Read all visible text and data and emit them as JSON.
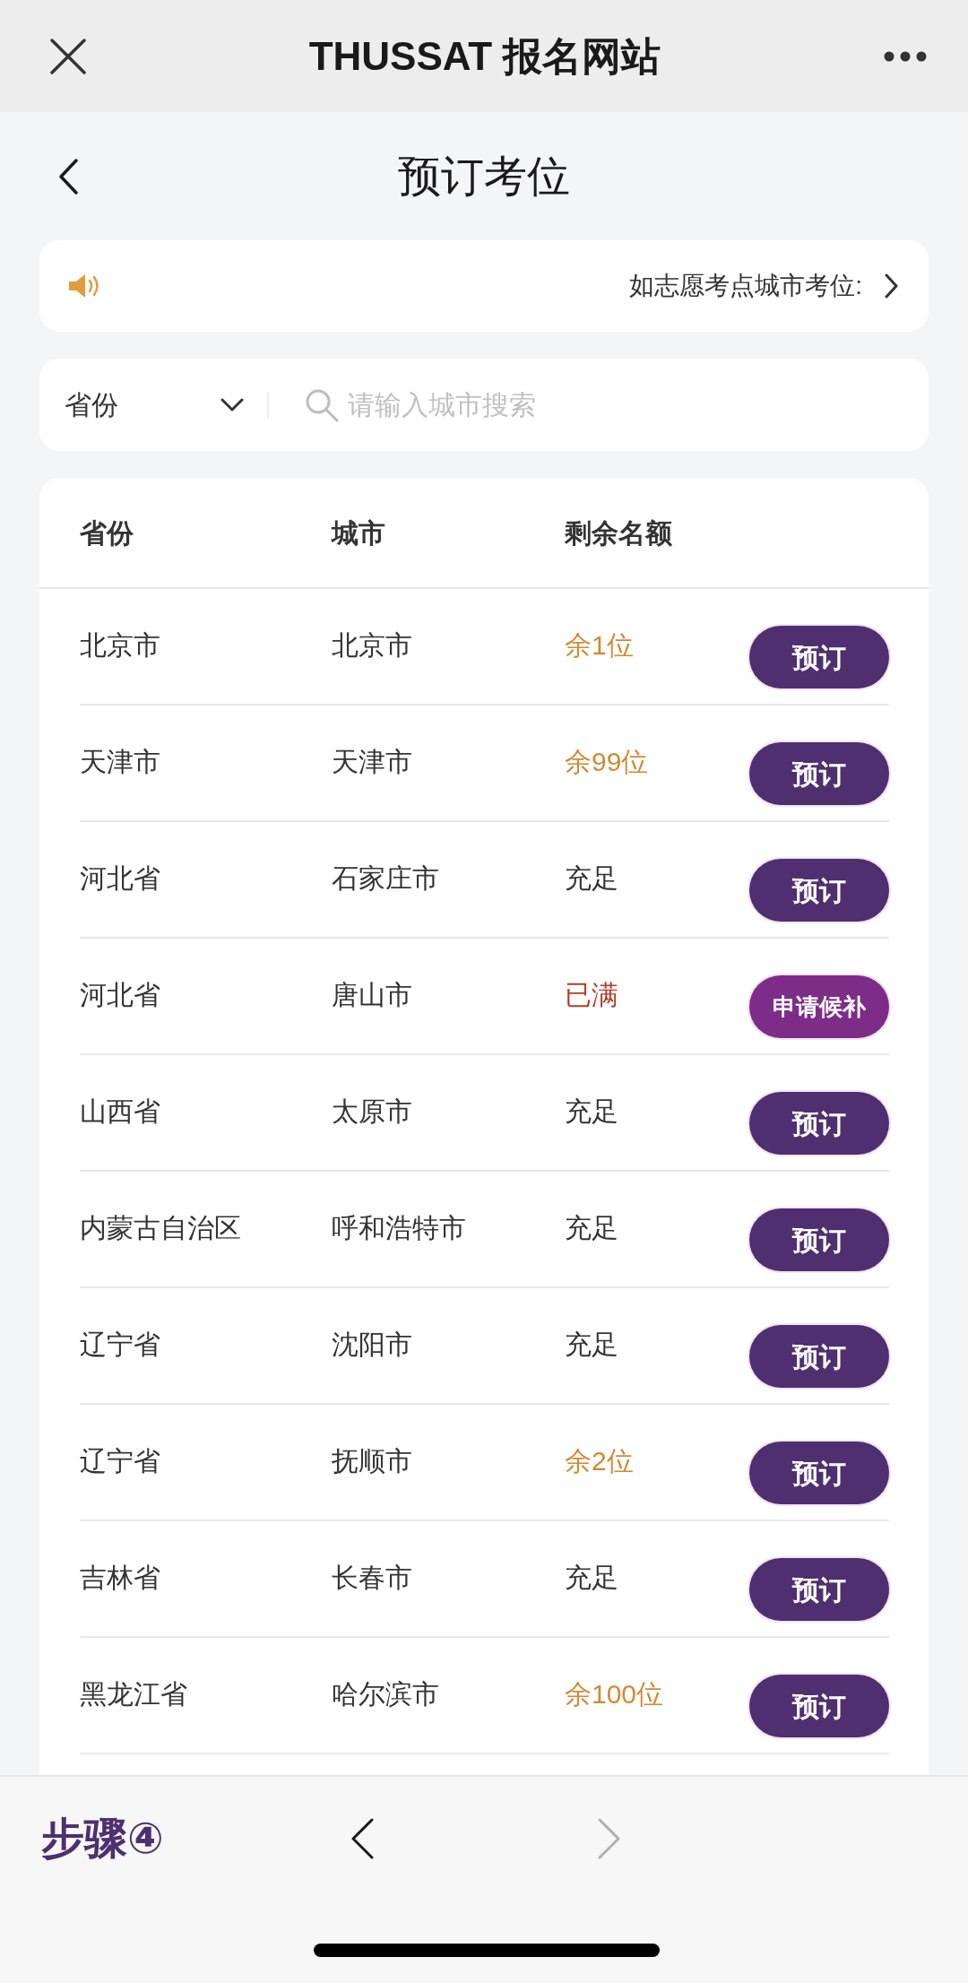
{
  "top_bar": {
    "title": "THUSSAT 报名网站"
  },
  "page_header": {
    "title": "预订考位"
  },
  "notice": {
    "text": "如志愿考点城市考位:"
  },
  "filter": {
    "province_select": "省份",
    "search": {
      "placeholder": "请输入城市搜索"
    }
  },
  "table": {
    "columns": [
      "省份",
      "城市",
      "剩余名额"
    ],
    "rows": [
      {
        "province": "北京市",
        "city": "北京市",
        "availability": {
          "text": "余1位",
          "kind": "limited"
        },
        "action": {
          "label": "预订",
          "kind": "book"
        }
      },
      {
        "province": "天津市",
        "city": "天津市",
        "availability": {
          "text": "余99位",
          "kind": "limited"
        },
        "action": {
          "label": "预订",
          "kind": "book"
        }
      },
      {
        "province": "河北省",
        "city": "石家庄市",
        "availability": {
          "text": "充足",
          "kind": "ample"
        },
        "action": {
          "label": "预订",
          "kind": "book"
        }
      },
      {
        "province": "河北省",
        "city": "唐山市",
        "availability": {
          "text": "已满",
          "kind": "full"
        },
        "action": {
          "label": "申请候补",
          "kind": "waitlist"
        }
      },
      {
        "province": "山西省",
        "city": "太原市",
        "availability": {
          "text": "充足",
          "kind": "ample"
        },
        "action": {
          "label": "预订",
          "kind": "book"
        }
      },
      {
        "province": "内蒙古自治区",
        "city": "呼和浩特市",
        "availability": {
          "text": "充足",
          "kind": "ample"
        },
        "action": {
          "label": "预订",
          "kind": "book"
        }
      },
      {
        "province": "辽宁省",
        "city": "沈阳市",
        "availability": {
          "text": "充足",
          "kind": "ample"
        },
        "action": {
          "label": "预订",
          "kind": "book"
        }
      },
      {
        "province": "辽宁省",
        "city": "抚顺市",
        "availability": {
          "text": "余2位",
          "kind": "limited"
        },
        "action": {
          "label": "预订",
          "kind": "book"
        }
      },
      {
        "province": "吉林省",
        "city": "长春市",
        "availability": {
          "text": "充足",
          "kind": "ample"
        },
        "action": {
          "label": "预订",
          "kind": "book"
        }
      },
      {
        "province": "黑龙江省",
        "city": "哈尔滨市",
        "availability": {
          "text": "余100位",
          "kind": "limited"
        },
        "action": {
          "label": "预订",
          "kind": "book"
        }
      }
    ]
  },
  "bottom_bar": {
    "step": "步骤④",
    "back": {
      "disabled": false
    },
    "forward": {
      "disabled": true
    }
  }
}
